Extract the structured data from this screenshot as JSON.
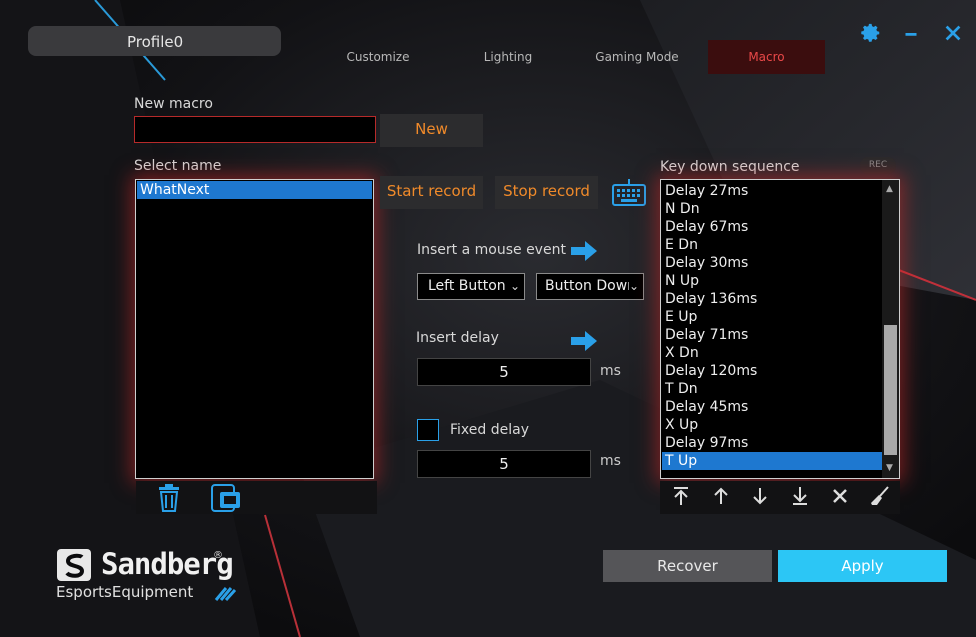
{
  "header": {
    "profile_name": "Profile0",
    "tabs": [
      {
        "label": "Customize",
        "active": false
      },
      {
        "label": "Lighting",
        "active": false
      },
      {
        "label": "Gaming Mode",
        "active": false
      },
      {
        "label": "Macro",
        "active": true
      }
    ],
    "window_controls": [
      "gear-icon",
      "minimize-icon",
      "close-icon"
    ]
  },
  "new_macro": {
    "label": "New macro",
    "input_value": "",
    "button_label": "New"
  },
  "select_name": {
    "label": "Select name",
    "items": [
      {
        "text": "WhatNext",
        "selected": true
      }
    ]
  },
  "recording": {
    "start_label": "Start record",
    "stop_label": "Stop record"
  },
  "mouse_event": {
    "label": "Insert a mouse event",
    "button_select": "Left Button",
    "action_select": "Button Down"
  },
  "delay": {
    "label": "Insert delay",
    "value": "5",
    "unit": "ms"
  },
  "fixed_delay": {
    "label": "Fixed delay",
    "checked": false,
    "value": "5",
    "unit": "ms"
  },
  "sequence": {
    "label": "Key down sequence",
    "rec_badge": "REC",
    "items": [
      {
        "text": "Delay 27ms",
        "selected": false
      },
      {
        "text": "N Dn",
        "selected": false
      },
      {
        "text": "Delay 67ms",
        "selected": false
      },
      {
        "text": "E Dn",
        "selected": false
      },
      {
        "text": "Delay 30ms",
        "selected": false
      },
      {
        "text": "N Up",
        "selected": false
      },
      {
        "text": "Delay 136ms",
        "selected": false
      },
      {
        "text": "E Up",
        "selected": false
      },
      {
        "text": "Delay 71ms",
        "selected": false
      },
      {
        "text": "X Dn",
        "selected": false
      },
      {
        "text": "Delay 120ms",
        "selected": false
      },
      {
        "text": "T Dn",
        "selected": false
      },
      {
        "text": "Delay 45ms",
        "selected": false
      },
      {
        "text": "X Up",
        "selected": false
      },
      {
        "text": "Delay 97ms",
        "selected": false
      },
      {
        "text": "T Up",
        "selected": true
      }
    ]
  },
  "footer": {
    "brand_name": "Sandberg",
    "brand_sub": "EsportsEquipment",
    "recover_label": "Recover",
    "apply_label": "Apply"
  },
  "colors": {
    "accent_orange": "#f08a2a",
    "accent_blue": "#2aa0e8",
    "active_tab_bg": "#3b0d0e",
    "selection": "#1e78d0",
    "apply_bg": "#2cc6f5"
  }
}
